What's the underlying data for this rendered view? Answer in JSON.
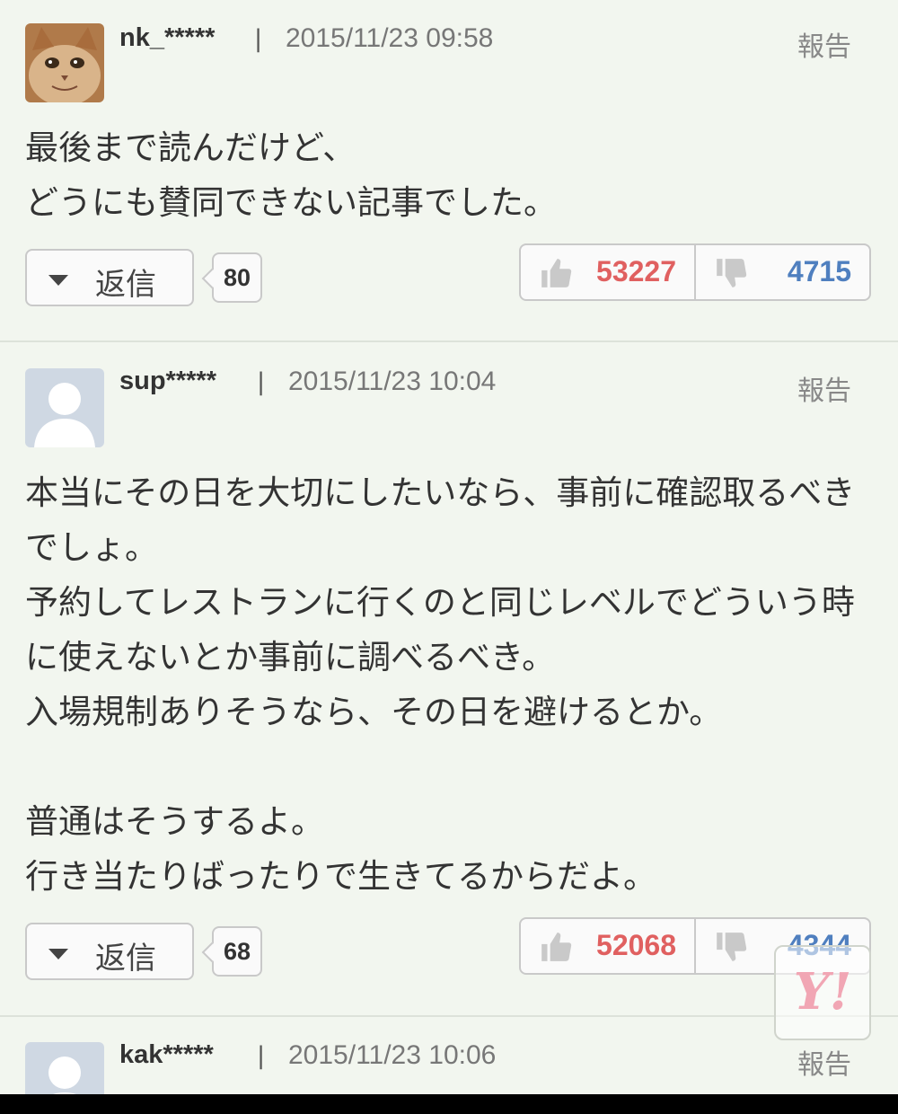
{
  "comments": [
    {
      "username": "nk_*****",
      "separator": "|",
      "timestamp": "2015/11/23 09:58",
      "report_label": "報告",
      "avatar": "cat-photo-avatar",
      "body": "最後まで読んだけど、\nどうにも賛同できない記事でした。",
      "reply_label": "返信",
      "reply_count": "80",
      "likes": "53227",
      "dislikes": "4715"
    },
    {
      "username": "sup*****",
      "separator": "|",
      "timestamp": "2015/11/23 10:04",
      "report_label": "報告",
      "avatar": "default-user-avatar",
      "body": "本当にその日を大切にしたいなら、事前に確認取るべきでしょ。\n予約してレストランに行くのと同じレベルでどういう時に使えないとか事前に調べるべき。\n入場規制ありそうなら、その日を避けるとか。\n\n普通はそうするよ。\n行き当たりばったりで生きてるからだよ。",
      "reply_label": "返信",
      "reply_count": "68",
      "likes": "52068",
      "dislikes": "4344"
    },
    {
      "username": "kak*****",
      "separator": "|",
      "timestamp": "2015/11/23 10:06",
      "report_label": "報告",
      "avatar": "default-user-avatar"
    }
  ],
  "overlay": {
    "logo_text": "Y!"
  },
  "icons": {
    "like": "thumbs-up-icon",
    "dislike": "thumbs-down-icon",
    "reply_toggle": "caret-down-icon"
  },
  "colors": {
    "background": "#f2f6ef",
    "like_count": "#e06060",
    "dislike_count": "#4f7fbf",
    "logo": "#f1a6b4"
  }
}
